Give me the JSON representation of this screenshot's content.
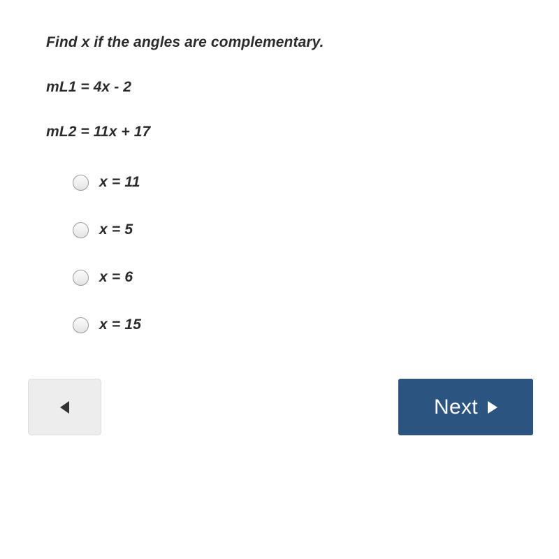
{
  "question": {
    "title": "Find x if the angles are complementary.",
    "equations": [
      "mL1  =  4x  - 2",
      "mL2  =  11x  +  17"
    ]
  },
  "options": [
    {
      "label": "x  =  11",
      "selected": false
    },
    {
      "label": "x  =  5",
      "selected": false
    },
    {
      "label": "x  =  6",
      "selected": false
    },
    {
      "label": "x  =  15",
      "selected": false
    }
  ],
  "navigation": {
    "back_icon": "triangle-left-icon",
    "next_label": "Next",
    "next_icon": "triangle-right-icon"
  },
  "colors": {
    "next_button_background": "#2b5580",
    "next_button_text": "#ffffff",
    "back_button_background": "#ededed",
    "back_button_border": "#dcdcdc",
    "text": "#2b2b2b",
    "radio_border": "#9a9a9a",
    "page_background": "#ffffff"
  }
}
